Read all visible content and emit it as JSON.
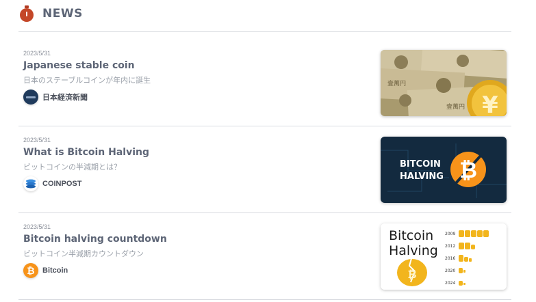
{
  "header": {
    "title": "NEWS",
    "icon": "stopwatch-icon"
  },
  "articles": [
    {
      "date": "2023/5/31",
      "title": "Japanese stable coin",
      "subtitle": "日本のステーブルコインが年内に誕生",
      "source": "日本経済新聞",
      "source_icon": "nikkei-logo",
      "thumbnail": "yen-banknotes-and-coin"
    },
    {
      "date": "2023/5/31",
      "title": "What is Bitcoin Halving",
      "subtitle": "ビットコインの半減期とは？",
      "source": "COINPOST",
      "source_icon": "coinpost-logo",
      "thumbnail": {
        "line1": "BITCOIN",
        "line2": "HALVING"
      }
    },
    {
      "date": "2023/5/31",
      "title": "Bitcoin halving countdown",
      "subtitle": "ビットコイン半減期カウントダウン",
      "source": "Bitcoin",
      "source_icon": "bitcoin-logo",
      "thumbnail": {
        "line1": "Bitcoin",
        "line2": "Halving",
        "years": [
          "2009",
          "2012",
          "2016",
          "2020",
          "2024"
        ]
      }
    }
  ],
  "colors": {
    "accent": "#c44728",
    "text": "#5d6576",
    "muted": "#9aa0a9",
    "bitcoin": "#f7931a"
  }
}
